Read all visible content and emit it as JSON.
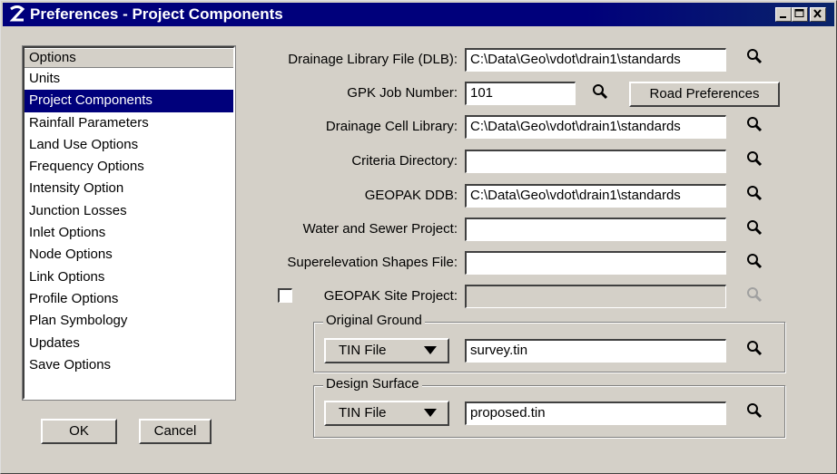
{
  "window": {
    "title": "Preferences - Project Components",
    "controls": [
      "minimize-icon",
      "maximize-icon",
      "close-icon"
    ]
  },
  "options_list": {
    "header": "Options",
    "items": [
      {
        "label": "Units",
        "selected": false
      },
      {
        "label": "Project Components",
        "selected": true
      },
      {
        "label": "Rainfall Parameters",
        "selected": false
      },
      {
        "label": "Land Use Options",
        "selected": false
      },
      {
        "label": "Frequency Options",
        "selected": false
      },
      {
        "label": "Intensity Option",
        "selected": false
      },
      {
        "label": "Junction Losses",
        "selected": false
      },
      {
        "label": "Inlet Options",
        "selected": false
      },
      {
        "label": "Node Options",
        "selected": false
      },
      {
        "label": "Link Options",
        "selected": false
      },
      {
        "label": "Profile Options",
        "selected": false
      },
      {
        "label": "Plan Symbology",
        "selected": false
      },
      {
        "label": "Updates",
        "selected": false
      },
      {
        "label": "Save Options",
        "selected": false
      }
    ]
  },
  "buttons": {
    "ok": "OK",
    "cancel": "Cancel",
    "road_preferences": "Road Preferences"
  },
  "fields": {
    "dlb": {
      "label": "Drainage Library File (DLB):",
      "value": "C:\\Data\\Geo\\vdot\\drain1\\standards"
    },
    "gpk": {
      "label": "GPK Job Number:",
      "value": "101"
    },
    "cell_library": {
      "label": "Drainage Cell Library:",
      "value": "C:\\Data\\Geo\\vdot\\drain1\\standards"
    },
    "criteria": {
      "label": "Criteria Directory:",
      "value": ""
    },
    "ddb": {
      "label": "GEOPAK DDB:",
      "value": "C:\\Data\\Geo\\vdot\\drain1\\standards"
    },
    "water_sewer": {
      "label": "Water and Sewer Project:",
      "value": ""
    },
    "superelevation": {
      "label": "Superelevation Shapes File:",
      "value": ""
    },
    "site_project": {
      "label": "GEOPAK Site Project:",
      "value": "",
      "checked": false,
      "enabled": false
    }
  },
  "original_ground": {
    "legend": "Original Ground",
    "type": "TIN File",
    "value": "survey.tin"
  },
  "design_surface": {
    "legend": "Design Surface",
    "type": "TIN File",
    "value": "proposed.tin"
  },
  "colors": {
    "titlebar": "#00007b",
    "selection": "#00007b",
    "dialog_bg": "#d4d0c8"
  },
  "icons": {
    "browse": "magnifier-icon"
  }
}
